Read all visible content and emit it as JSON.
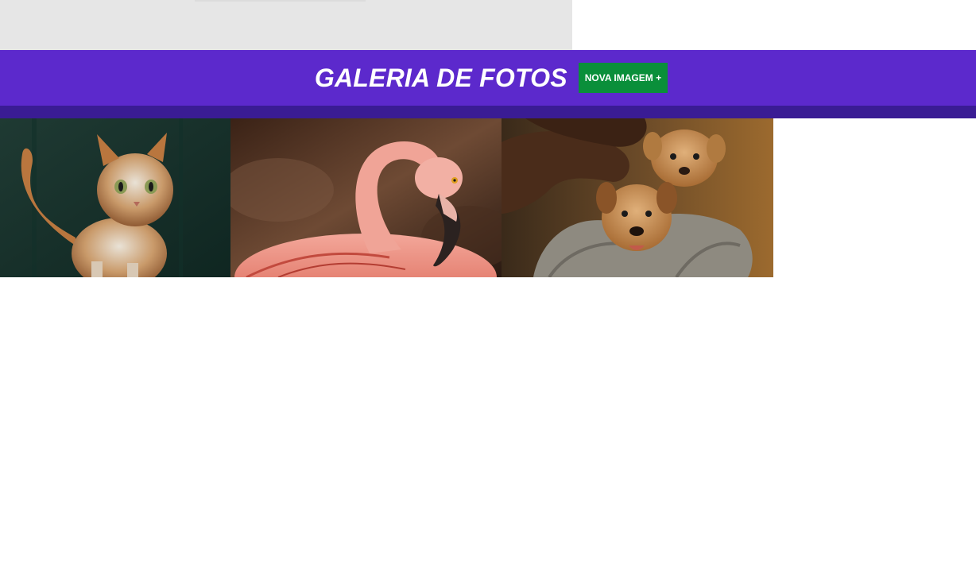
{
  "header": {
    "title": "GALERIA DE FOTOS",
    "new_image_label": "NOVA IMAGEM +"
  },
  "gallery": {
    "photos": [
      {
        "subject": "cat"
      },
      {
        "subject": "flamingo"
      },
      {
        "subject": "puppies"
      }
    ]
  },
  "colors": {
    "header_bg": "#5c29cc",
    "header_strip": "#3a1c94",
    "button_bg": "#0a8f3a",
    "top_bar": "#e6e6e6"
  }
}
